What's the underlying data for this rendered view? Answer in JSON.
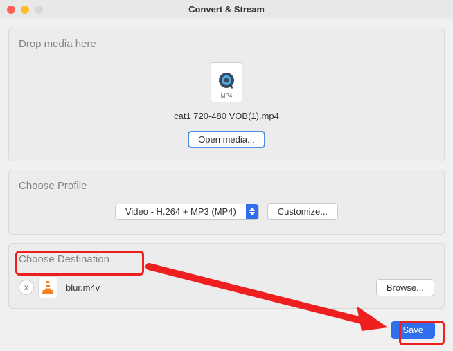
{
  "window": {
    "title": "Convert & Stream"
  },
  "drop": {
    "title": "Drop media here",
    "file_ext": "MP4",
    "filename": "cat1 720-480 VOB(1).mp4",
    "open_button": "Open media..."
  },
  "profile": {
    "title": "Choose Profile",
    "selected": "Video - H.264 + MP3 (MP4)",
    "customize_button": "Customize..."
  },
  "destination": {
    "title": "Choose Destination",
    "remove_label": "x",
    "filename": "blur.m4v",
    "browse_button": "Browse..."
  },
  "footer": {
    "save_button": "Save"
  }
}
